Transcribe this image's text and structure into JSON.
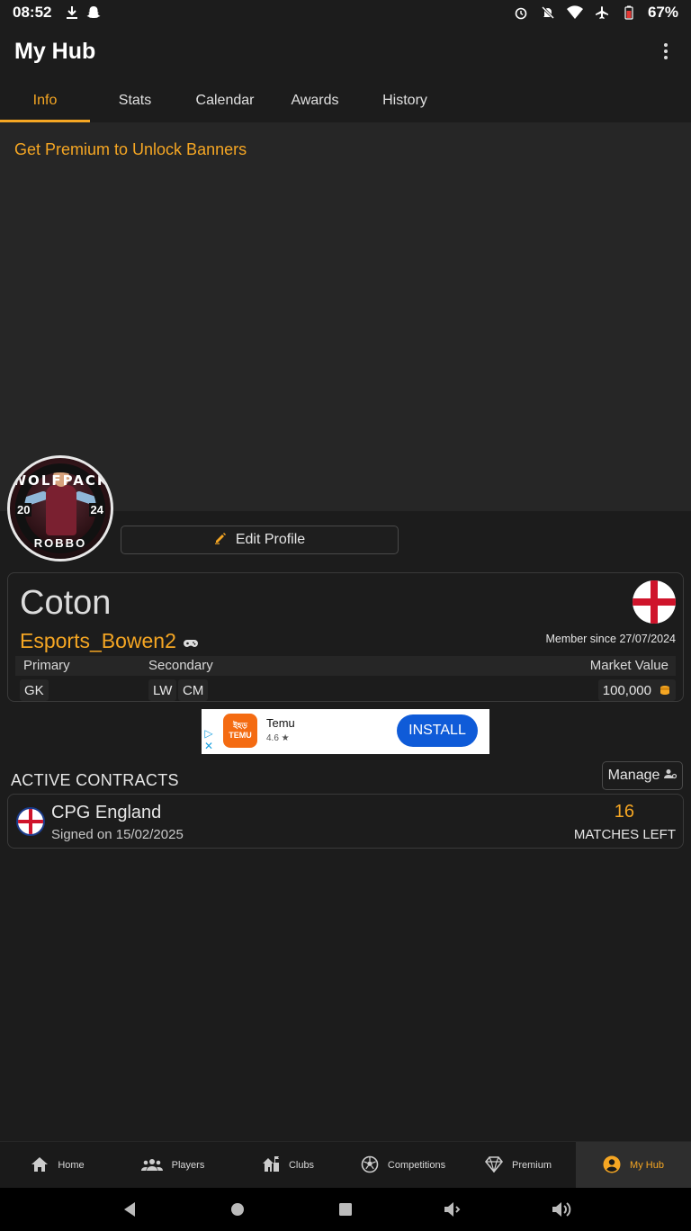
{
  "status_bar": {
    "time": "08:52",
    "battery": "67%"
  },
  "app_bar": {
    "title": "My Hub"
  },
  "tabs": [
    {
      "label": "Info",
      "active": true
    },
    {
      "label": "Stats"
    },
    {
      "label": "Calendar"
    },
    {
      "label": "Awards"
    },
    {
      "label": "History"
    }
  ],
  "banner": {
    "promo_text": "Get Premium to Unlock Banners"
  },
  "avatar": {
    "text_top": "WOLFPACK",
    "text_bottom": "ROBBO",
    "year_left": "20",
    "year_right": "24"
  },
  "profile": {
    "edit_label": "Edit Profile",
    "name": "Coton",
    "gamertag": "Esports_Bowen2",
    "member_since": "Member since 27/07/2024",
    "headers": {
      "primary": "Primary",
      "secondary": "Secondary",
      "market_value": "Market Value"
    },
    "primary_position": "GK",
    "secondary_positions": [
      "LW",
      "CM"
    ],
    "market_value": "100,000"
  },
  "ad": {
    "app_name": "Temu",
    "rating": "4.6 ★",
    "install_label": "INSTALL",
    "logo_line1": "ইহড়",
    "logo_line2": "TEMU"
  },
  "contracts": {
    "title": "ACTIVE CONTRACTS",
    "manage_label": "Manage",
    "items": [
      {
        "club": "CPG England",
        "signed": "Signed on 15/02/2025",
        "matches_left": "16",
        "matches_left_label": "MATCHES LEFT"
      }
    ]
  },
  "bottom_nav": [
    {
      "label": "Home",
      "icon": "home-icon"
    },
    {
      "label": "Players",
      "icon": "players-icon"
    },
    {
      "label": "Clubs",
      "icon": "clubs-icon"
    },
    {
      "label": "Competitions",
      "icon": "soccer-ball-icon"
    },
    {
      "label": "Premium",
      "icon": "diamond-icon"
    },
    {
      "label": "My Hub",
      "icon": "account-icon",
      "active": true
    }
  ],
  "colors": {
    "accent": "#f5a623",
    "background": "#1c1c1c",
    "install_button": "#0f5bd8"
  }
}
